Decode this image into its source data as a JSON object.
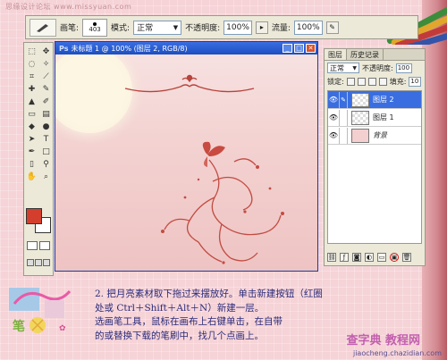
{
  "watermark": "思缘设计论坛 www.missyuan.com",
  "options_bar": {
    "brush_label": "画笔:",
    "brush_size": "403",
    "mode_label": "模式:",
    "mode_value": "正常",
    "opacity_label": "不透明度:",
    "opacity_value": "100%",
    "flow_label": "流量:",
    "flow_value": "100%"
  },
  "document": {
    "ps_badge": "Ps",
    "title": "未标题 1 @ 100% (图层 2, RGB/8)"
  },
  "layers_panel": {
    "tabs": [
      "图层",
      "历史记录"
    ],
    "blend_mode": "正常",
    "opacity_label": "不透明度:",
    "opacity_value": "100",
    "lock_label": "锁定:",
    "fill_label": "填充:",
    "fill_value": "10",
    "layers": [
      {
        "name": "图层 2",
        "selected": true,
        "thumb": "transparent",
        "italic": false
      },
      {
        "name": "图层 1",
        "selected": false,
        "thumb": "transparent",
        "italic": false
      },
      {
        "name": "背景",
        "selected": false,
        "thumb": "pink",
        "italic": true
      }
    ]
  },
  "instructions": [
    "2. 把月亮素材取下拖过来摆放好。单击新建按钮（红圈",
    "处或 Ctrl＋Shift＋Alt＋N）新建一层。",
    "选画笔工具，鼠标在画布上右键单击，在自带",
    "的或替换下载的笔刷中，找几个点画上。"
  ],
  "footer": {
    "brand": "查字典 教程网",
    "url": "jiaocheng.chazidian.com"
  },
  "colors": {
    "foreground": "#d33f2c",
    "background": "#ffffff",
    "accent_blue": "#3a6ee0",
    "canvas_pink": "#f3d2d1"
  }
}
